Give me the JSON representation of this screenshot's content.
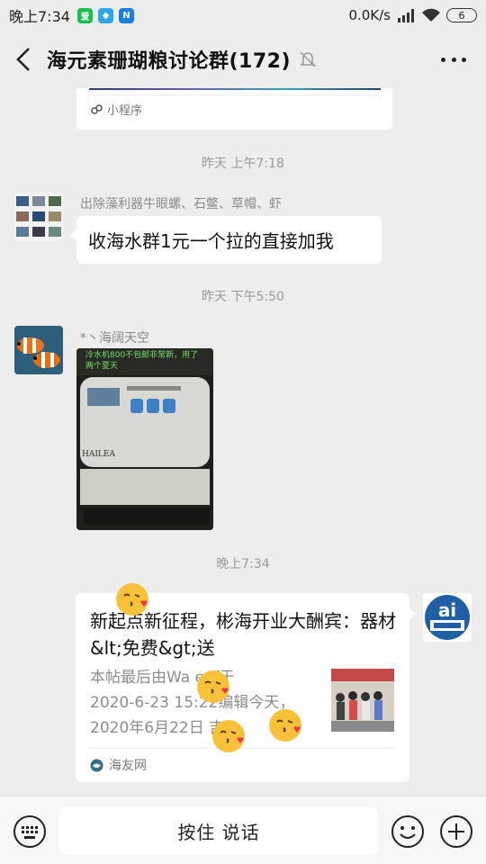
{
  "status_bar": {
    "time": "晚上7:34",
    "network_speed": "0.0K/s",
    "battery": "6",
    "app_icons": [
      "iqiyi-icon",
      "app-icon-blue",
      "n-app-icon"
    ]
  },
  "header": {
    "title": "海元素珊瑚粮讨论群(172)"
  },
  "messages": {
    "prev_card": {
      "source": "小程序"
    },
    "ts1": "昨天 上午7:18",
    "msg1": {
      "sender": "出除藻利器牛眼螺、石鳖、草帽、虾",
      "text": "收海水群1元一个拉的直接加我"
    },
    "ts2": "昨天 下午5:50",
    "msg2": {
      "sender": "*丶海阔天空",
      "photo_overlay": "冷水机800不包邮非常新，用了两个夏天",
      "photo_brand": "HAILEA"
    },
    "ts3": "晚上7:34",
    "msg3": {
      "title": "新起点新征程，彬海开业大酬宾：器材&lt;免费&gt;送",
      "desc_line1": "本帖最后由Wa  eef于",
      "desc_line2": "2020-6-23 15:22编辑今天，",
      "desc_line3": "2020年6月22日    吉",
      "source": "海友网"
    }
  },
  "input_bar": {
    "hold_to_talk": "按住 说话"
  },
  "colors": {
    "background": "#ededed",
    "bubble": "#ffffff",
    "muted_text": "#9a9a9a"
  }
}
